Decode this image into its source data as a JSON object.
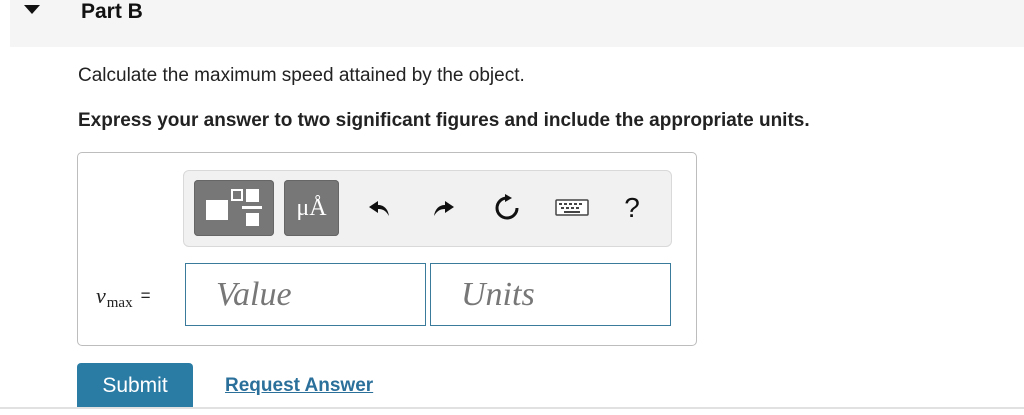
{
  "part": {
    "title": "Part B",
    "expanded": true
  },
  "question": "Calculate the maximum speed attained by the object.",
  "instruction": "Express your answer to two significant figures and include the appropriate units.",
  "toolbar": {
    "template_button": "templates-icon",
    "units_button_label": "μÅ",
    "undo": "undo-icon",
    "redo": "redo-icon",
    "reset": "reset-icon",
    "keyboard": "keyboard-icon",
    "help_label": "?"
  },
  "answer": {
    "variable": "v",
    "subscript": "max",
    "equals": "=",
    "value_placeholder": "Value",
    "units_placeholder": "Units"
  },
  "actions": {
    "submit_label": "Submit",
    "request_label": "Request Answer"
  },
  "colors": {
    "accent": "#2b7ca5",
    "link": "#2b6f9b",
    "field_border": "#3a7a9a"
  }
}
